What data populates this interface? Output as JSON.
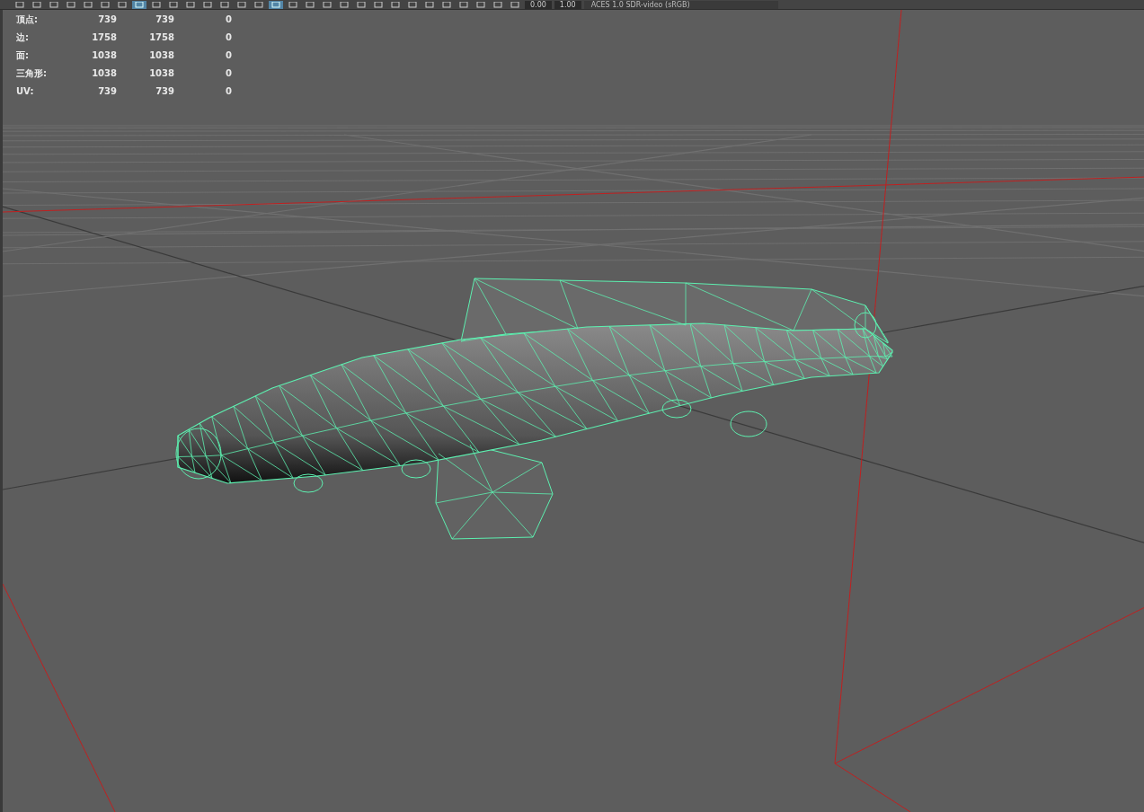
{
  "toolbar": {
    "tool_buttons": [
      {
        "selected": false
      },
      {
        "selected": false
      },
      {
        "selected": false
      },
      {
        "selected": false
      },
      {
        "selected": false
      },
      {
        "selected": false
      },
      {
        "selected": false
      },
      {
        "selected": true
      },
      {
        "selected": false
      },
      {
        "selected": false
      },
      {
        "selected": false
      },
      {
        "selected": false
      },
      {
        "selected": false
      },
      {
        "selected": false
      },
      {
        "selected": false
      },
      {
        "selected": true
      },
      {
        "selected": false
      },
      {
        "selected": false
      },
      {
        "selected": false
      },
      {
        "selected": false
      },
      {
        "selected": false
      },
      {
        "selected": false
      },
      {
        "selected": false
      },
      {
        "selected": false
      },
      {
        "selected": false
      },
      {
        "selected": false
      },
      {
        "selected": false
      },
      {
        "selected": false
      },
      {
        "selected": false
      },
      {
        "selected": false
      }
    ],
    "exposure": "0.00",
    "gamma": "1.00",
    "color_space": "ACES 1.0 SDR-video (sRGB)"
  },
  "heads_up_stats": [
    {
      "label": "顶点:",
      "values": [
        "739",
        "739",
        "0"
      ]
    },
    {
      "label": "边:",
      "values": [
        "1758",
        "1758",
        "0"
      ]
    },
    {
      "label": "面:",
      "values": [
        "1038",
        "1038",
        "0"
      ]
    },
    {
      "label": "三角形:",
      "values": [
        "1038",
        "1038",
        "0"
      ]
    },
    {
      "label": "UV:",
      "values": [
        "739",
        "739",
        "0"
      ]
    }
  ]
}
